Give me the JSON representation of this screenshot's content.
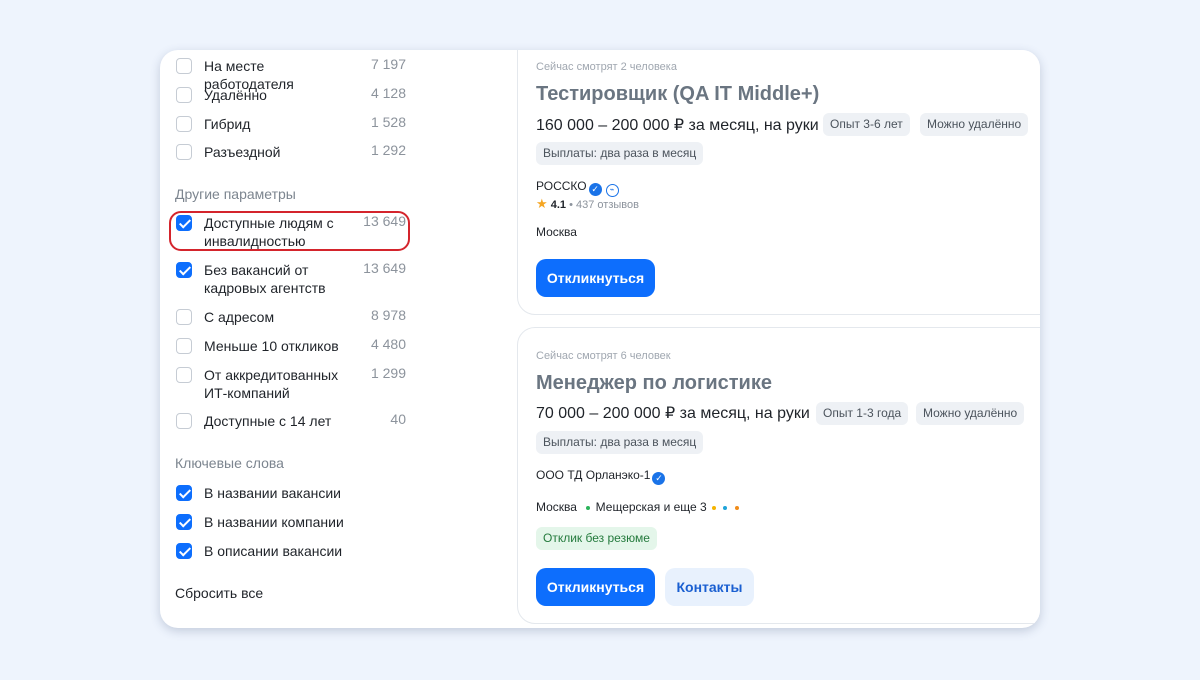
{
  "filters": {
    "work_format": [
      {
        "label": "На месте работодателя",
        "count": "7 197",
        "checked": false
      },
      {
        "label": "Удалённо",
        "count": "4 128",
        "checked": false
      },
      {
        "label": "Гибрид",
        "count": "1 528",
        "checked": false
      },
      {
        "label": "Разъездной",
        "count": "1 292",
        "checked": false
      }
    ],
    "other_title": "Другие параметры",
    "other": [
      {
        "label": "Доступные людям с инвалидностью",
        "count": "13 649",
        "checked": true
      },
      {
        "label": "Без вакансий от кадровых агентств",
        "count": "13 649",
        "checked": true
      },
      {
        "label": "С адресом",
        "count": "8 978",
        "checked": false
      },
      {
        "label": "Меньше 10 откликов",
        "count": "4 480",
        "checked": false
      },
      {
        "label": "От аккредитованных ИТ-компаний",
        "count": "1 299",
        "checked": false
      },
      {
        "label": "Доступные с 14 лет",
        "count": "40",
        "checked": false
      }
    ],
    "keywords_title": "Ключевые слова",
    "keywords": [
      {
        "label": "В названии вакансии",
        "checked": true
      },
      {
        "label": "В названии компании",
        "checked": true
      },
      {
        "label": "В описании вакансии",
        "checked": true
      }
    ],
    "reset_label": "Сбросить все"
  },
  "vacancies": [
    {
      "watching": "Сейчас смотрят 2 человека",
      "title": "Тестировщик (QA IT Middle+)",
      "salary": "160 000 – 200 000 ₽ за месяц, на руки",
      "experience": "Опыт 3-6 лет",
      "remote": "Можно удалённо",
      "payouts": "Выплаты: два раза в месяц",
      "company": "РОССКО",
      "rating": "4.1",
      "reviews": "437 отзывов",
      "city": "Москва",
      "apply_label": "Откликнуться"
    },
    {
      "watching": "Сейчас смотрят 6 человек",
      "title": "Менеджер по логистике",
      "salary": "70 000 – 200 000 ₽ за месяц, на руки",
      "experience": "Опыт 1-3 года",
      "remote": "Можно удалённо",
      "payouts": "Выплаты: два раза в месяц",
      "company": "ООО ТД Орланэко-1",
      "city": "Москва",
      "metro": "Мещерская и еще 3",
      "no_resume": "Отклик без резюме",
      "apply_label": "Откликнуться",
      "contacts_label": "Контакты"
    }
  ],
  "colors": {
    "accent": "#0d6efd",
    "highlight": "#d4242c",
    "metro_dots": [
      "#2bb35a",
      "#f5b400",
      "#1fa4d9",
      "#f08c1a"
    ]
  }
}
